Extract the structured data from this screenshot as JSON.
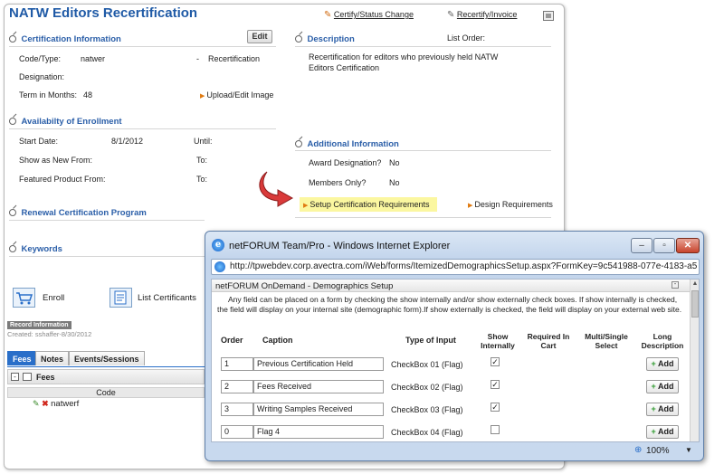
{
  "page": {
    "title": "NATW Editors Recertification",
    "top_links": {
      "certify": "Certify/Status Change",
      "recertify": "Recertify/Invoice"
    }
  },
  "cert_info": {
    "title": "Certification Information",
    "edit_label": "Edit",
    "code_type_label": "Code/Type:",
    "code_value": "natwer",
    "dash": "-",
    "type_value": "Recertification",
    "designation_label": "Designation:",
    "term_label": "Term in Months:",
    "term_value": "48",
    "upload_link": "Upload/Edit Image"
  },
  "description": {
    "title": "Description",
    "list_order_label": "List Order:",
    "text": "Recertification for editors who previously held NATW Editors Certification"
  },
  "availability": {
    "title": "Availabilty of Enrollment",
    "start_label": "Start Date:",
    "start_value": "8/1/2012",
    "until_label": "Until:",
    "show_new_label": "Show as New From:",
    "to_label_1": "To:",
    "featured_label": "Featured Product From:",
    "to_label_2": "To:"
  },
  "additional": {
    "title": "Additional Information",
    "award_label": "Award Designation?",
    "award_value": "No",
    "members_label": "Members Only?",
    "members_value": "No",
    "setup_link": "Setup Certification Requirements",
    "design_link": "Design Requirements"
  },
  "renewal": {
    "title": "Renewal Certification Program"
  },
  "keywords": {
    "title": "Keywords"
  },
  "actions": {
    "enroll": "Enroll",
    "list_certificants": "List Certificants"
  },
  "record": {
    "header": "Record Information",
    "created": "Created: sshaffer-8/30/2012"
  },
  "tabs": [
    "Fees",
    "Notes",
    "Events/Sessions"
  ],
  "fees": {
    "header": "Fees",
    "code_column": "Code",
    "row_code": "natwerf"
  },
  "ie_window": {
    "title": "netFORUM Team/Pro - Windows Internet Explorer",
    "address": "http://tpwebdev.corp.avectra.com/iWeb/forms/ItemizedDemographicsSetup.aspx?FormKey=9c541988-077e-4183-a5",
    "panel_title": "netFORUM OnDemand - Demographics Setup",
    "intro": "Any field can be placed on a form by checking the show internally and/or show externally check boxes. If show internally is checked, the field will display on your internal site (demographic form).If show externally is checked, the field will display on your external web site.",
    "columns": {
      "order": "Order",
      "caption": "Caption",
      "type": "Type of Input",
      "show_internally": "Show Internally",
      "required": "Required In Cart",
      "multi": "Multi/Single Select",
      "long_desc": "Long Description"
    },
    "rows": [
      {
        "order": "1",
        "caption": "Previous Certification Held",
        "type": "CheckBox 01 (Flag)",
        "checked": "✓",
        "add": "Add"
      },
      {
        "order": "2",
        "caption": "Fees Received",
        "type": "CheckBox 02 (Flag)",
        "checked": "✓",
        "add": "Add"
      },
      {
        "order": "3",
        "caption": "Writing Samples Received",
        "type": "CheckBox 03 (Flag)",
        "checked": "✓",
        "add": "Add"
      },
      {
        "order": "0",
        "caption": "Flag 4",
        "type": "CheckBox 04 (Flag)",
        "checked": "",
        "add": "Add"
      }
    ],
    "zoom": "100%"
  },
  "colors": {
    "accent": "#1f5aa6",
    "highlight": "#fbf7a0",
    "tab_active": "#2a6fc9"
  },
  "icons": [
    "pdf-icon",
    "collapse-circle-icon",
    "red-curved-arrow-icon",
    "enroll-cart-icon",
    "list-certificants-icon",
    "edit-pencil-icon",
    "delete-x-icon",
    "ie-logo-icon",
    "zoom-icon"
  ]
}
